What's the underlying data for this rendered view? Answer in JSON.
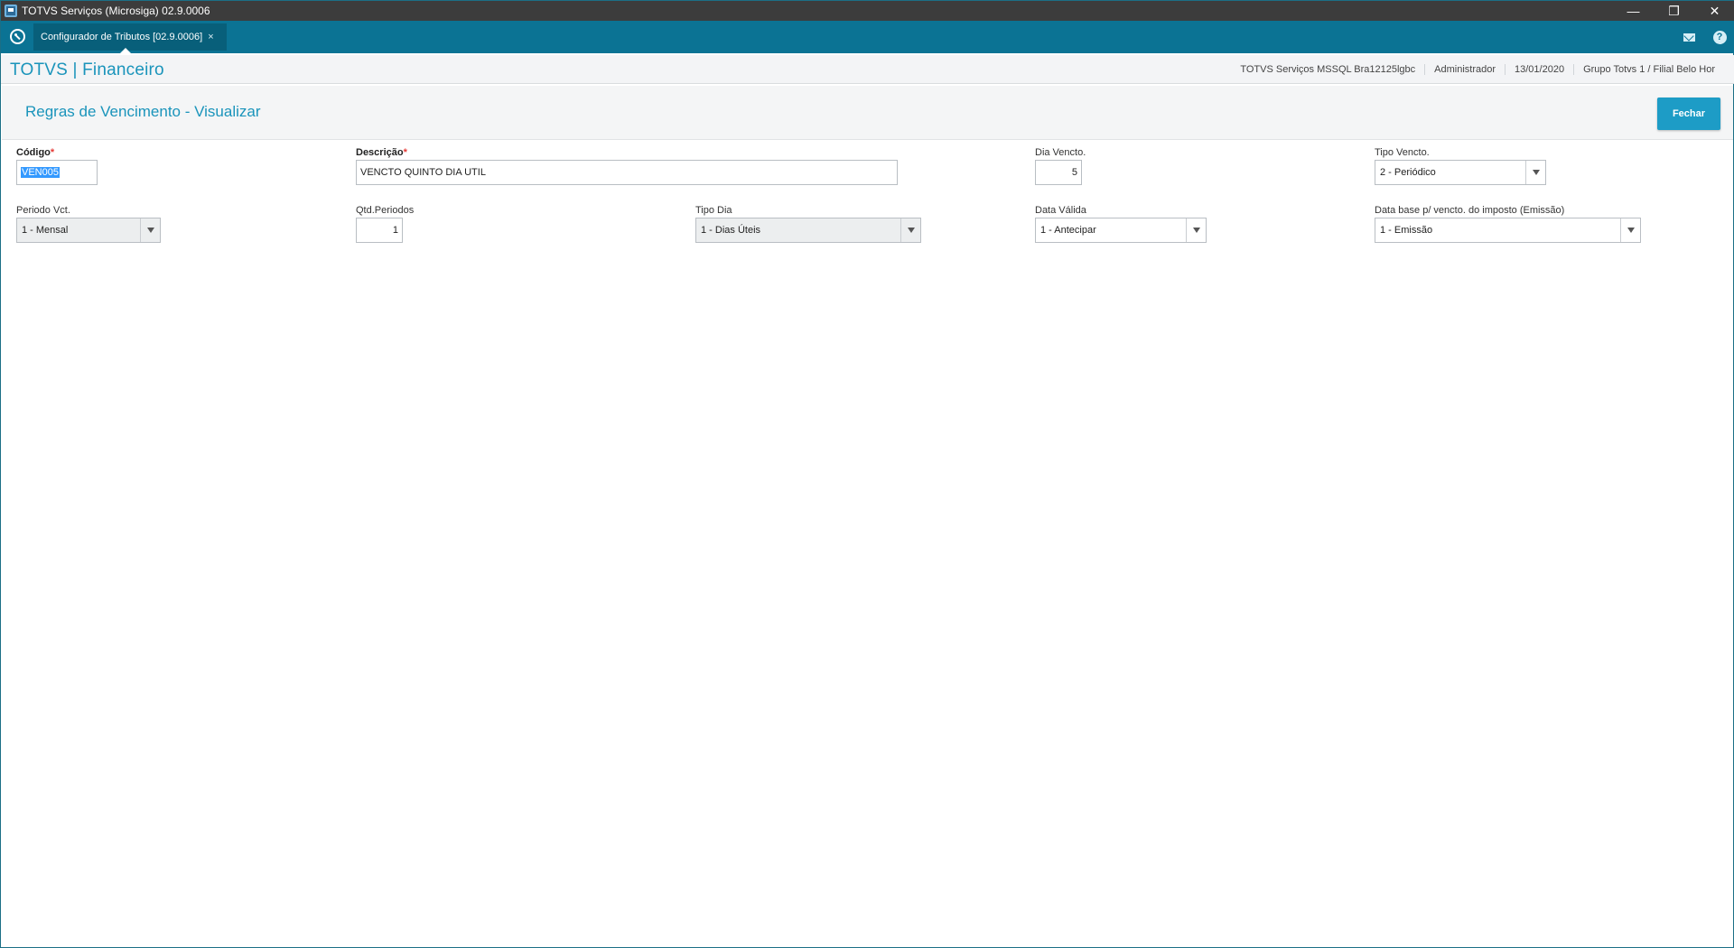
{
  "window": {
    "title": "TOTVS Serviços (Microsiga) 02.9.0006",
    "controls": {
      "minimize": "—",
      "restore": "❐",
      "close": "✕"
    }
  },
  "tabbar": {
    "tab_label": "Configurador de Tributos [02.9.0006]",
    "tab_close": "×"
  },
  "header": {
    "brand": "TOTVS | Financeiro",
    "environment": "TOTVS Serviços MSSQL Bra12125lgbc",
    "user": "Administrador",
    "date": "13/01/2020",
    "company": "Grupo Totvs 1 / Filial Belo Hor"
  },
  "page": {
    "title": "Regras de Vencimento - Visualizar",
    "close_button": "Fechar"
  },
  "form": {
    "codigo": {
      "label": "Código",
      "required_mark": "*",
      "value": "VEN005"
    },
    "descricao": {
      "label": "Descrição",
      "required_mark": "*",
      "value": "VENCTO QUINTO DIA UTIL"
    },
    "dia_vencto": {
      "label": "Dia Vencto.",
      "value": "5"
    },
    "tipo_vencto": {
      "label": "Tipo Vencto.",
      "value": "2 - Periódico"
    },
    "periodo_vct": {
      "label": "Periodo Vct.",
      "value": "1 - Mensal"
    },
    "qtd_periodos": {
      "label": "Qtd.Periodos",
      "value": "1"
    },
    "tipo_dia": {
      "label": "Tipo Dia",
      "value": "1 - Dias Úteis"
    },
    "data_valida": {
      "label": "Data Válida",
      "value": "1 - Antecipar"
    },
    "data_base": {
      "label": "Data base p/ vencto. do imposto (Emissão)",
      "value": "1 - Emissão"
    }
  }
}
